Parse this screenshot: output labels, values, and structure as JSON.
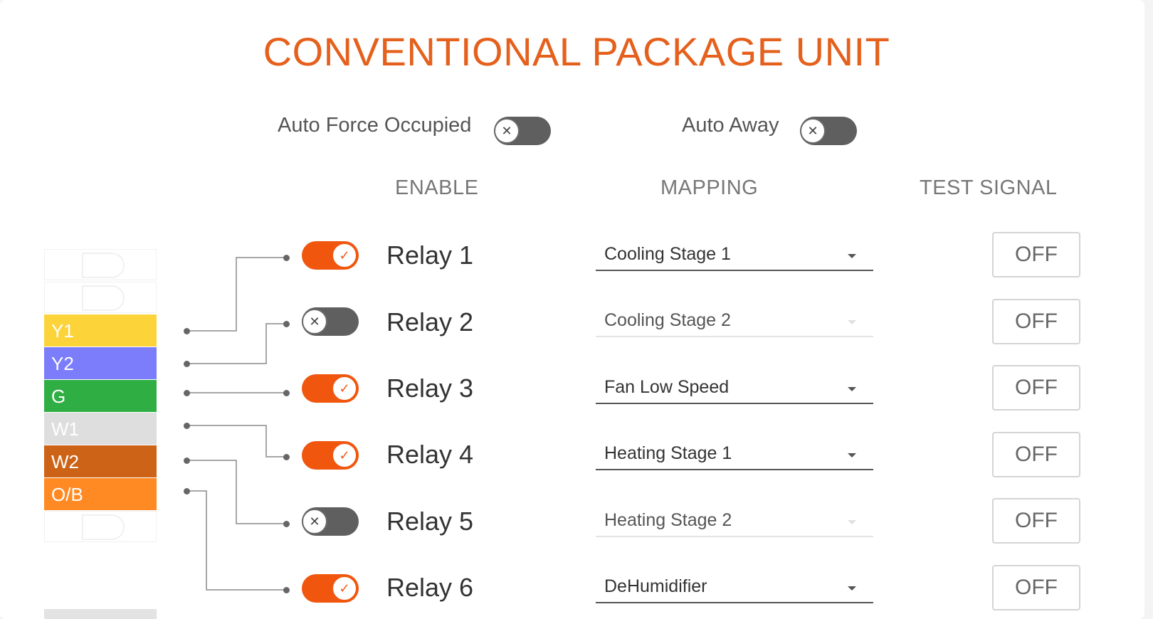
{
  "title": "CONVENTIONAL PACKAGE UNIT",
  "options": {
    "auto_force_occupied": {
      "label": "Auto Force Occupied",
      "enabled": false
    },
    "auto_away": {
      "label": "Auto Away",
      "enabled": false
    }
  },
  "columns": {
    "enable": "ENABLE",
    "mapping": "MAPPING",
    "test_signal": "TEST SIGNAL"
  },
  "relays": [
    {
      "label": "Relay 1",
      "enabled": true,
      "mapping": "Cooling Stage 1",
      "test": "OFF"
    },
    {
      "label": "Relay 2",
      "enabled": false,
      "mapping": "Cooling Stage 2",
      "test": "OFF"
    },
    {
      "label": "Relay 3",
      "enabled": true,
      "mapping": "Fan Low Speed",
      "test": "OFF"
    },
    {
      "label": "Relay 4",
      "enabled": true,
      "mapping": "Heating Stage 1",
      "test": "OFF"
    },
    {
      "label": "Relay 5",
      "enabled": false,
      "mapping": "Heating Stage 2",
      "test": "OFF"
    },
    {
      "label": "Relay 6",
      "enabled": true,
      "mapping": "DeHumidifier",
      "test": "OFF"
    }
  ],
  "terminals": [
    {
      "label": "Y1",
      "color": "#fcd43a"
    },
    {
      "label": "Y2",
      "color": "#7b7dfb"
    },
    {
      "label": "G",
      "color": "#2fae43"
    },
    {
      "label": "W1",
      "color": "#dedede"
    },
    {
      "label": "W2",
      "color": "#cc6317"
    },
    {
      "label": "O/B",
      "color": "#ff8a24"
    }
  ],
  "icons": {
    "toggle_on": "check-icon",
    "toggle_off": "x-icon",
    "dropdown": "caret-down-icon"
  }
}
